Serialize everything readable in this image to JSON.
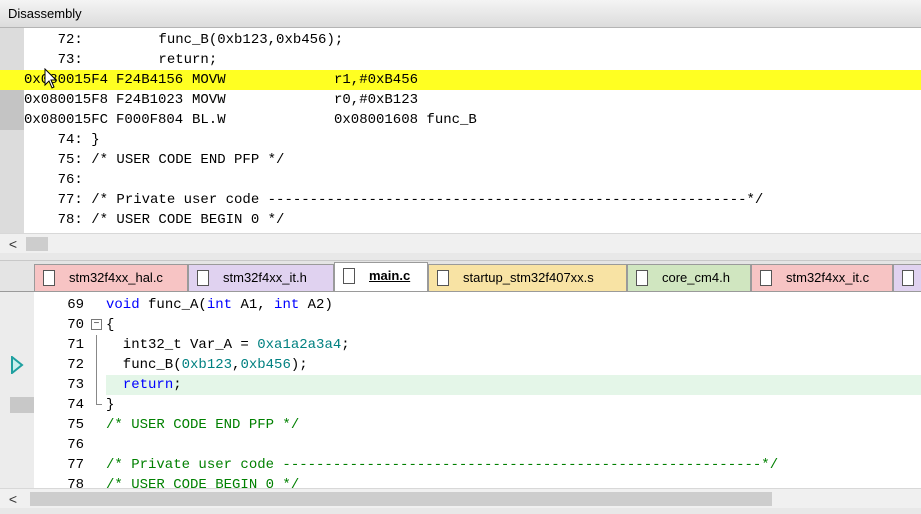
{
  "disassembly": {
    "title": "Disassembly",
    "lines": [
      {
        "kind": "src",
        "text": "    72:         func_B(0xb123,0xb456);"
      },
      {
        "kind": "src",
        "text": "    73:         return;"
      },
      {
        "kind": "asm",
        "addr": "0x080015F4",
        "opcode": "F24B4156",
        "mnemonic": "MOVW",
        "operands": "r1,#0xB456",
        "current": true
      },
      {
        "kind": "asm",
        "addr": "0x080015F8",
        "opcode": "F24B1023",
        "mnemonic": "MOVW",
        "operands": "r0,#0xB123"
      },
      {
        "kind": "asm",
        "addr": "0x080015FC",
        "opcode": "F000F804",
        "mnemonic": "BL.W",
        "operands": "0x08001608 func_B"
      },
      {
        "kind": "src",
        "text": "    74: }"
      },
      {
        "kind": "src",
        "text": "    75: /* USER CODE END PFP */"
      },
      {
        "kind": "src",
        "text": "    76: "
      },
      {
        "kind": "src",
        "text": "    77: /* Private user code ---------------------------------------------------------*/"
      },
      {
        "kind": "src",
        "text": "    78: /* USER CODE BEGIN 0 */"
      }
    ],
    "scroll_left_icon": "<"
  },
  "tabs": [
    {
      "label": "stm32f4xx_hal.c",
      "color": "#f7c4c4",
      "active": false
    },
    {
      "label": "stm32f4xx_it.h",
      "color": "#e0d2f0",
      "active": false
    },
    {
      "label": "main.c",
      "color": "#ffffff",
      "active": true
    },
    {
      "label": "startup_stm32f407xx.s",
      "color": "#f8e3a4",
      "active": false
    },
    {
      "label": "core_cm4.h",
      "color": "#d0e6c0",
      "active": false
    },
    {
      "label": "stm32f4xx_it.c",
      "color": "#f7c4c4",
      "active": false
    },
    {
      "label": "",
      "color": "#e0d2f0",
      "active": false
    }
  ],
  "editor": {
    "lines": [
      {
        "num": "69",
        "parts": [
          {
            "t": "void ",
            "c": "kw"
          },
          {
            "t": "func_A(",
            "c": ""
          },
          {
            "t": "int ",
            "c": "kw"
          },
          {
            "t": "A1, ",
            "c": ""
          },
          {
            "t": "int ",
            "c": "kw"
          },
          {
            "t": "A2)",
            "c": ""
          }
        ]
      },
      {
        "num": "70",
        "fold": "open",
        "parts": [
          {
            "t": "{",
            "c": ""
          }
        ]
      },
      {
        "num": "71",
        "fold": "line",
        "parts": [
          {
            "t": "  int32_t Var_A = ",
            "c": ""
          },
          {
            "t": "0xa1a2a3a4",
            "c": "num"
          },
          {
            "t": ";",
            "c": ""
          }
        ]
      },
      {
        "num": "72",
        "fold": "line",
        "arrow": true,
        "parts": [
          {
            "t": "  func_B(",
            "c": ""
          },
          {
            "t": "0xb123",
            "c": "num"
          },
          {
            "t": ",",
            "c": ""
          },
          {
            "t": "0xb456",
            "c": "num"
          },
          {
            "t": ");",
            "c": ""
          }
        ]
      },
      {
        "num": "73",
        "fold": "line",
        "current": true,
        "parts": [
          {
            "t": "  ",
            "c": ""
          },
          {
            "t": "return",
            "c": "kw"
          },
          {
            "t": ";",
            "c": ""
          }
        ]
      },
      {
        "num": "74",
        "fold": "end",
        "gray": true,
        "parts": [
          {
            "t": "}",
            "c": ""
          }
        ]
      },
      {
        "num": "75",
        "parts": [
          {
            "t": "/* USER CODE END PFP */",
            "c": "cmt"
          }
        ]
      },
      {
        "num": "76",
        "parts": []
      },
      {
        "num": "77",
        "parts": [
          {
            "t": "/* Private user code ---------------------------------------------------------*/",
            "c": "cmt"
          }
        ]
      },
      {
        "num": "78",
        "parts": [
          {
            "t": "/* USER CODE BEGIN 0 */",
            "c": "cmt"
          }
        ]
      }
    ],
    "scroll_left_icon": "<"
  },
  "colors": {
    "current_instruction": "#ffff22",
    "current_line": "#e4f6e8",
    "keyword": "#0000ff",
    "number": "#008080",
    "comment": "#008000",
    "exec_arrow": "#1fa0a0"
  }
}
